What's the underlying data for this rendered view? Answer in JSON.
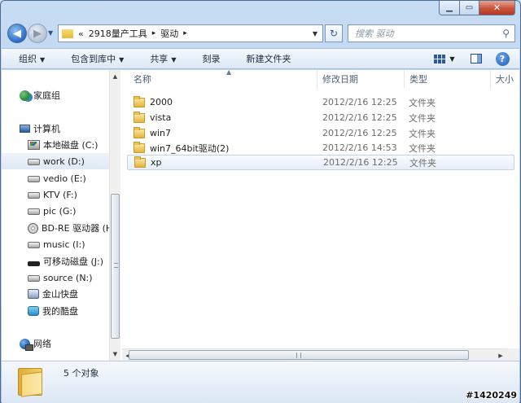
{
  "address": {
    "crumbs": [
      "2918量产工具",
      "驱动"
    ],
    "overflow": "«",
    "separator": "▸"
  },
  "search": {
    "placeholder": "搜索 驱动"
  },
  "toolbar": {
    "organize": "组织",
    "include_in_library": "包含到库中",
    "share": "共享",
    "burn": "刻录",
    "new_folder": "新建文件夹"
  },
  "nav": {
    "homegroup": "家庭组",
    "computer": "计算机",
    "drives": [
      {
        "label": "本地磁盘 (C:)",
        "icon": "local-disk-icon"
      },
      {
        "label": "work (D:)",
        "icon": "drive-icon",
        "selected": true
      },
      {
        "label": "vedio (E:)",
        "icon": "drive-icon"
      },
      {
        "label": "KTV (F:)",
        "icon": "drive-icon"
      },
      {
        "label": "pic (G:)",
        "icon": "drive-icon"
      },
      {
        "label": "BD-RE 驱动器 (H",
        "icon": "disc-drive-icon"
      },
      {
        "label": "music (I:)",
        "icon": "drive-icon"
      },
      {
        "label": "可移动磁盘 (J:)",
        "icon": "usb-drive-icon"
      },
      {
        "label": "source (N:)",
        "icon": "drive-icon"
      },
      {
        "label": "金山快盘",
        "icon": "kuaipan-icon"
      },
      {
        "label": "我的酷盘",
        "icon": "cloud-drive-icon"
      }
    ],
    "network": "网络"
  },
  "columns": {
    "name": "名称",
    "modified": "修改日期",
    "type": "类型",
    "size": "大小"
  },
  "files": [
    {
      "name": "2000",
      "modified": "2012/2/16 12:25",
      "type": "文件夹"
    },
    {
      "name": "vista",
      "modified": "2012/2/16 12:25",
      "type": "文件夹"
    },
    {
      "name": "win7",
      "modified": "2012/2/16 12:25",
      "type": "文件夹"
    },
    {
      "name": "win7_64bit驱动(2)",
      "modified": "2012/2/16 14:53",
      "type": "文件夹"
    },
    {
      "name": "xp",
      "modified": "2012/2/16 12:25",
      "type": "文件夹",
      "selected": true
    }
  ],
  "status": {
    "item_count": "5 个对象"
  },
  "watermark": "#1420249"
}
